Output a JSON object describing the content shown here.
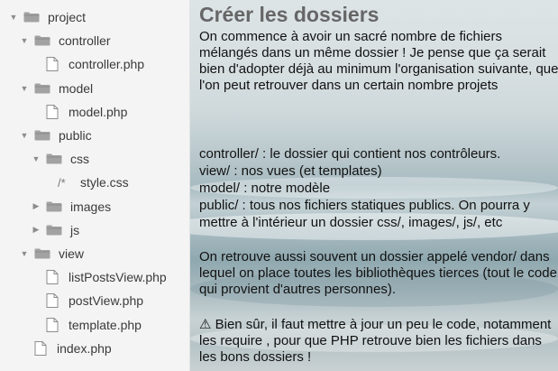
{
  "tree": [
    {
      "label": "project",
      "type": "folder",
      "open": true,
      "depth": 0
    },
    {
      "label": "controller",
      "type": "folder",
      "open": true,
      "depth": 1
    },
    {
      "label": "controller.php",
      "type": "file",
      "depth": 2
    },
    {
      "label": "model",
      "type": "folder",
      "open": true,
      "depth": 1
    },
    {
      "label": "model.php",
      "type": "file",
      "depth": 2
    },
    {
      "label": "public",
      "type": "folder",
      "open": true,
      "depth": 1
    },
    {
      "label": "css",
      "type": "folder",
      "open": true,
      "depth": 2
    },
    {
      "label": "style.css",
      "type": "css",
      "depth": 3
    },
    {
      "label": "images",
      "type": "folder",
      "open": false,
      "depth": 2
    },
    {
      "label": "js",
      "type": "folder",
      "open": false,
      "depth": 2
    },
    {
      "label": "view",
      "type": "folder",
      "open": true,
      "depth": 1
    },
    {
      "label": "listPostsView.php",
      "type": "file",
      "depth": 2
    },
    {
      "label": "postView.php",
      "type": "file",
      "depth": 2
    },
    {
      "label": "template.php",
      "type": "file",
      "depth": 2
    },
    {
      "label": "index.php",
      "type": "file",
      "depth": 1
    }
  ],
  "icons": {
    "css_comment": "/*"
  },
  "article": {
    "title": "Créer les dossiers",
    "intro": "On commence à avoir un sacré nombre de fichiers mélangés dans un même dossier ! Je pense que ça serait bien d'adopter déjà au minimum l'organisation suivante, que l'on peut retrouver dans un certain nombre projets",
    "list": [
      "controller/ : le dossier qui contient nos contrôleurs.",
      "view/ : nos vues (et templates)",
      "model/ : notre modèle",
      "public/ : tous nos fichiers statiques publics. On pourra y mettre à l'intérieur un dossier css/, images/, js/, etc"
    ],
    "vendor_note": "On retrouve aussi souvent un dossier appelé vendor/ dans lequel on place toutes les bibliothèques tierces (tout le code qui provient d'autres personnes).",
    "warning": "⚠ Bien sûr, il faut mettre à jour un peu le code, notamment les require , pour que PHP retrouve bien les fichiers dans les bons dossiers !"
  },
  "colors": {
    "folder": "#9a9a9a",
    "tree_bg": "#f4f4f4",
    "title": "#666666"
  }
}
